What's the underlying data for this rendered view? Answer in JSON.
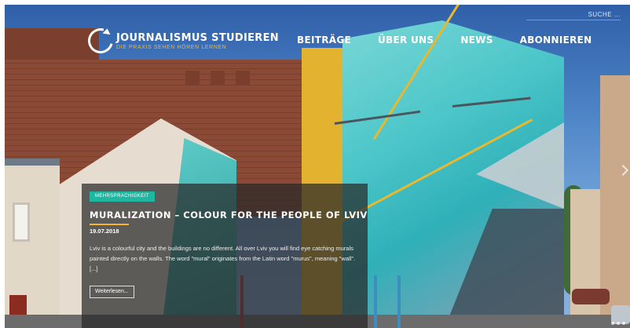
{
  "header": {
    "search_placeholder": "SUCHE ...",
    "logo": {
      "title": "JOURNALISMUS STUDIEREN",
      "subtitle": "DIE PRAXIS SEHEN HÖREN LERNEN"
    },
    "nav": [
      {
        "label": "BEITRÄGE"
      },
      {
        "label": "ÜBER UNS"
      },
      {
        "label": "NEWS"
      },
      {
        "label": "ABONNIEREN"
      }
    ]
  },
  "feature": {
    "category": "MEHRSPRACHIGKEIT",
    "title": "MURALIZATION – COLOUR FOR THE PEOPLE OF LVIV",
    "date": "19.07.2018",
    "excerpt": "Lviv is a colourful city and the buildings are no different. All over Lviv you will find eye catching murals painted directly on the walls. The word \"mural\" originates from the Latin word \"murus\", meaning \"wall\". [...]",
    "read_more": "Weiterlesen..."
  },
  "colors": {
    "accent": "#f3b534",
    "category_badge": "#1fb6a2",
    "overlay": "#282828"
  },
  "icons": [
    "logo-ring-icon",
    "slider-next-icon"
  ]
}
